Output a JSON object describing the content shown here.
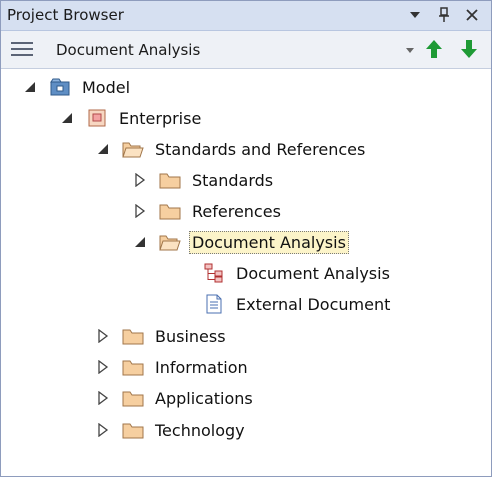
{
  "panel": {
    "title": "Project Browser",
    "dropdown_icon": "triangle-down-icon",
    "pin_icon": "pin-icon",
    "close_icon": "close-icon"
  },
  "toolbar": {
    "current_view": "Document Analysis",
    "menu_icon": "hamburger-icon",
    "move_up_icon": "arrow-up-icon",
    "move_down_icon": "arrow-down-icon"
  },
  "tree": {
    "model": "Model",
    "enterprise": "Enterprise",
    "standards_and_references": "Standards and References",
    "standards": "Standards",
    "references": "References",
    "document_analysis_pkg": "Document Analysis",
    "document_analysis_diagram": "Document Analysis",
    "external_document": "External Document",
    "business": "Business",
    "information": "Information",
    "applications": "Applications",
    "technology": "Technology"
  },
  "colors": {
    "titlebar_bg": "#d6e0f1",
    "toolbar_bg": "#eef1f6",
    "folder_fill": "#f6cfa0",
    "folder_stroke": "#a0764a",
    "selection_bg": "#fcf4c9",
    "arrow_green": "#1e9a35"
  }
}
